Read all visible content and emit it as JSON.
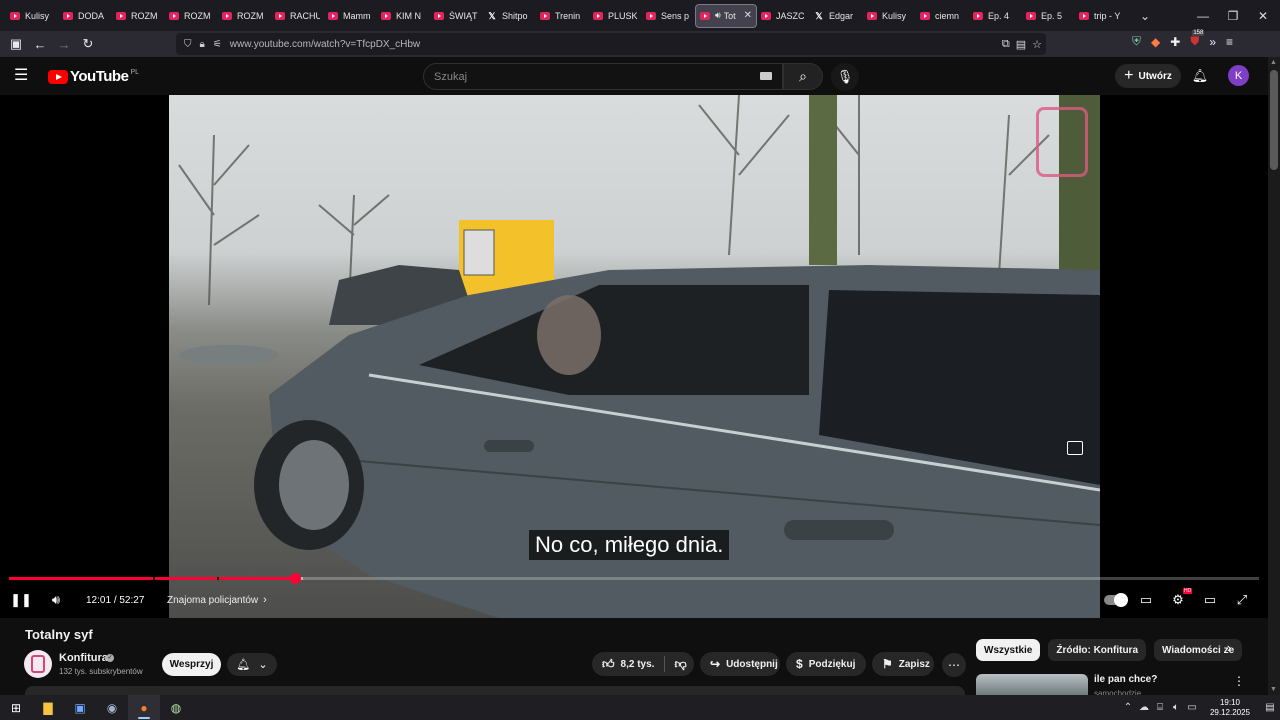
{
  "browser": {
    "tabs": [
      {
        "label": "Kulisy",
        "fav": "yt"
      },
      {
        "label": "DODA",
        "fav": "yt"
      },
      {
        "label": "ROZM",
        "fav": "yt"
      },
      {
        "label": "ROZM",
        "fav": "yt"
      },
      {
        "label": "ROZM",
        "fav": "yt"
      },
      {
        "label": "RACHU",
        "fav": "yt"
      },
      {
        "label": "Mamm",
        "fav": "yt"
      },
      {
        "label": "KIM N",
        "fav": "yt"
      },
      {
        "label": "ŚWIĄT",
        "fav": "yt"
      },
      {
        "label": "Shitpo",
        "fav": "x"
      },
      {
        "label": "Trenin",
        "fav": "yt"
      },
      {
        "label": "PLUSK",
        "fav": "yt"
      },
      {
        "label": "Sens p",
        "fav": "yt"
      },
      {
        "label": "Tot",
        "fav": "yt",
        "active": true
      },
      {
        "label": "JASZC",
        "fav": "yt"
      },
      {
        "label": "Edgar",
        "fav": "x"
      },
      {
        "label": "Kulisy",
        "fav": "yt"
      },
      {
        "label": "ciemn",
        "fav": "yt"
      },
      {
        "label": "Ep. 4",
        "fav": "yt"
      },
      {
        "label": "Ep. 5",
        "fav": "yt"
      },
      {
        "label": "trip - Y",
        "fav": "yt"
      }
    ],
    "url": "www.youtube.com/watch?v=TfcpDX_cHbw",
    "extension_badge": "158"
  },
  "youtube": {
    "logo_text": "YouTube",
    "region": "PL",
    "search_placeholder": "Szukaj",
    "create_label": "Utwórz",
    "avatar_letter": "K"
  },
  "player": {
    "subtitle": "No co, miłego dnia.",
    "current_time": "12:01",
    "duration": "52:27",
    "time_sep": "/",
    "chapter": "Znajoma policjantów",
    "played_fraction": 0.229,
    "loaded_fraction": 0.235,
    "chapter_gaps": [
      0.115,
      0.166
    ],
    "hd_badge": "HD"
  },
  "video": {
    "title": "Totalny syf",
    "channel": "Konfitura",
    "subscribers": "132 tys. subskrybentów",
    "support_label": "Wesprzyj",
    "likes": "8,2 tys.",
    "share_label": "Udostępnij",
    "thanks_label": "Podziękuj",
    "save_label": "Zapisz"
  },
  "sidebar": {
    "chips": [
      "Wszystkie",
      "Źródło: Konfitura",
      "Wiadomości ze"
    ],
    "rec_title": "ile pan chce?",
    "rec_channel": "samochodzie"
  },
  "taskbar": {
    "time": "19:10",
    "date": "29.12.2025"
  },
  "colors": {
    "accent": "#ff0033",
    "tab_favicon": "#e0245e",
    "avatar": "#7e3fc4"
  }
}
